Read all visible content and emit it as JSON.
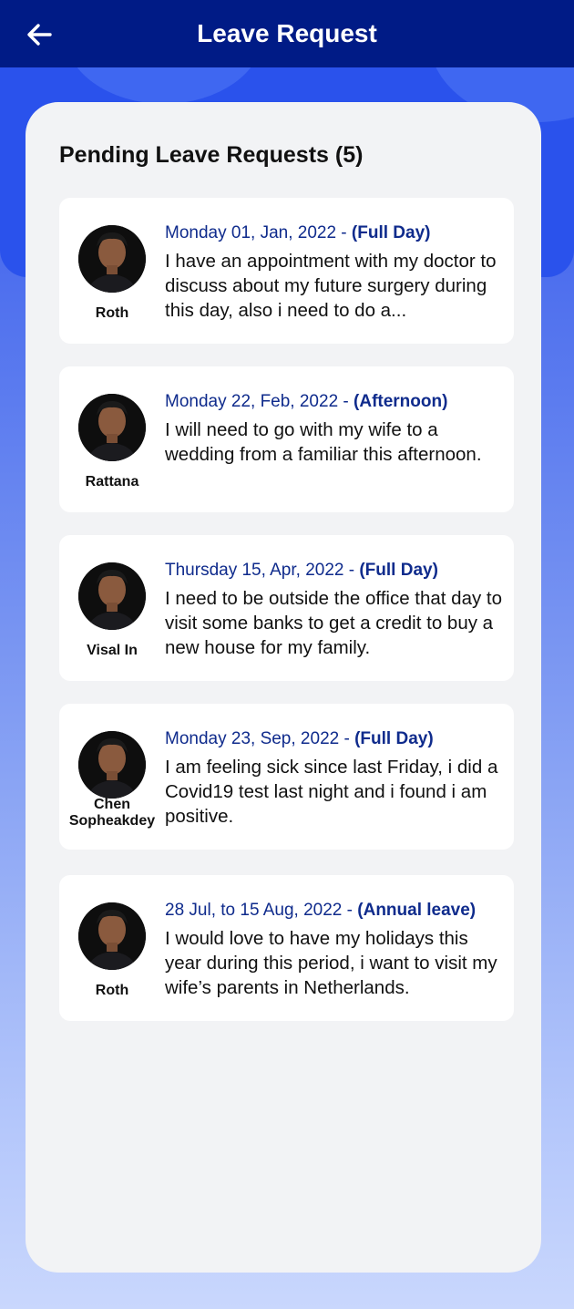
{
  "header": {
    "title": "Leave Request",
    "back_icon": "arrow-left-icon"
  },
  "section": {
    "title": "Pending Leave Requests (5)"
  },
  "colors": {
    "header_bg": "#001b86",
    "accent_text": "#0f2b8c",
    "card_bg": "#f2f3f5"
  },
  "requests": [
    {
      "name": "Roth",
      "date": "Monday  01, Jan,  2022 - ",
      "type": "(Full Day)",
      "reason": "I have an appointment with my doctor to discuss about my future surgery during this day, also i need to do a..."
    },
    {
      "name": "Rattana",
      "date": "Monday  22, Feb, 2022 - ",
      "type": "(Afternoon)",
      "reason": "I will need to go with my wife to a wedding from a familiar this afternoon."
    },
    {
      "name": "Visal In",
      "date": "Thursday 15, Apr,  2022 - ",
      "type": "(Full Day)",
      "reason": "I need to be outside the office that day to visit some banks to get a credit to buy a new house for my family."
    },
    {
      "name": "Chen Sopheakdey",
      "date": "Monday  23, Sep,  2022 - ",
      "type": "(Full Day)",
      "reason": "I am feeling sick since last Friday, i did a Covid19 test last night and i found i am positive."
    },
    {
      "name": "Roth",
      "date": "28 Jul, to 15 Aug, 2022 - ",
      "type": "(Annual leave)",
      "reason": "I would love to have my holidays this year during this period, i want to visit my wife’s parents in Netherlands."
    }
  ]
}
